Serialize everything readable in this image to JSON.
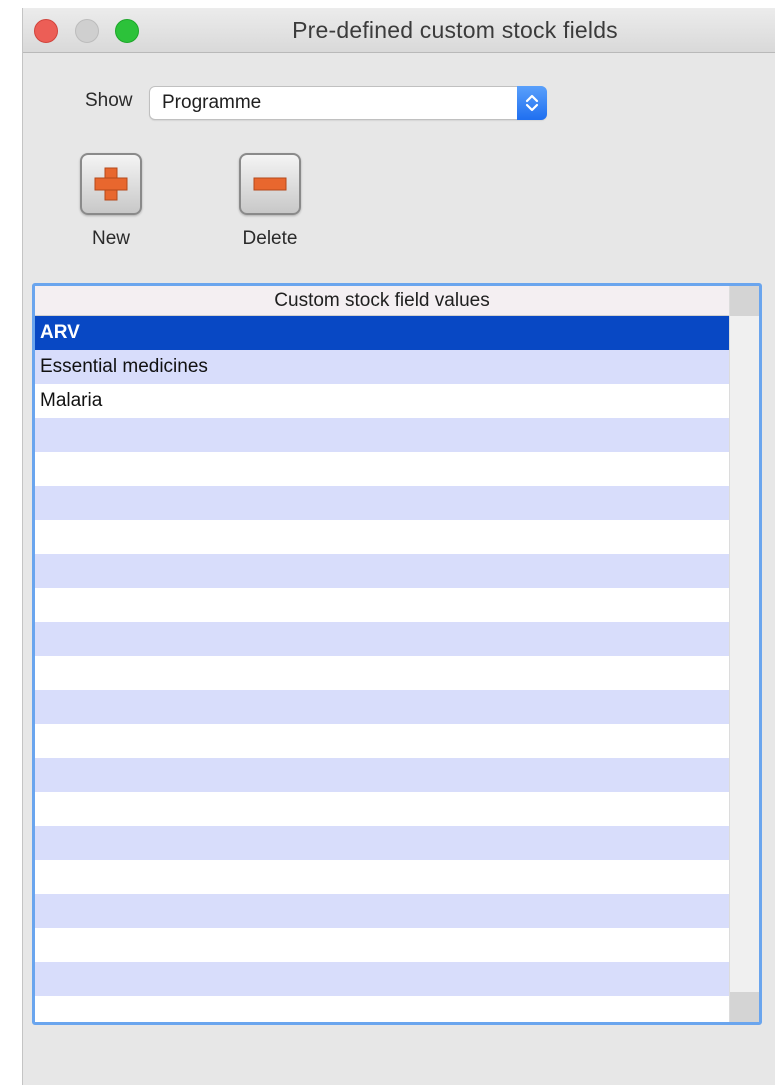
{
  "window": {
    "title": "Pre-defined custom stock fields"
  },
  "filter": {
    "label": "Show",
    "selected": "Programme"
  },
  "toolbar": {
    "new_label": "New",
    "delete_label": "Delete"
  },
  "list": {
    "header": "Custom stock field values",
    "items": [
      {
        "label": "ARV",
        "selected": true
      },
      {
        "label": "Essential medicines",
        "selected": false
      },
      {
        "label": "Malaria",
        "selected": false
      }
    ]
  },
  "colors": {
    "selection": "#0848c4",
    "stripe": "#d8ddfb",
    "focus_ring": "#6aa5ee",
    "button_glyph": "#e8672e"
  }
}
